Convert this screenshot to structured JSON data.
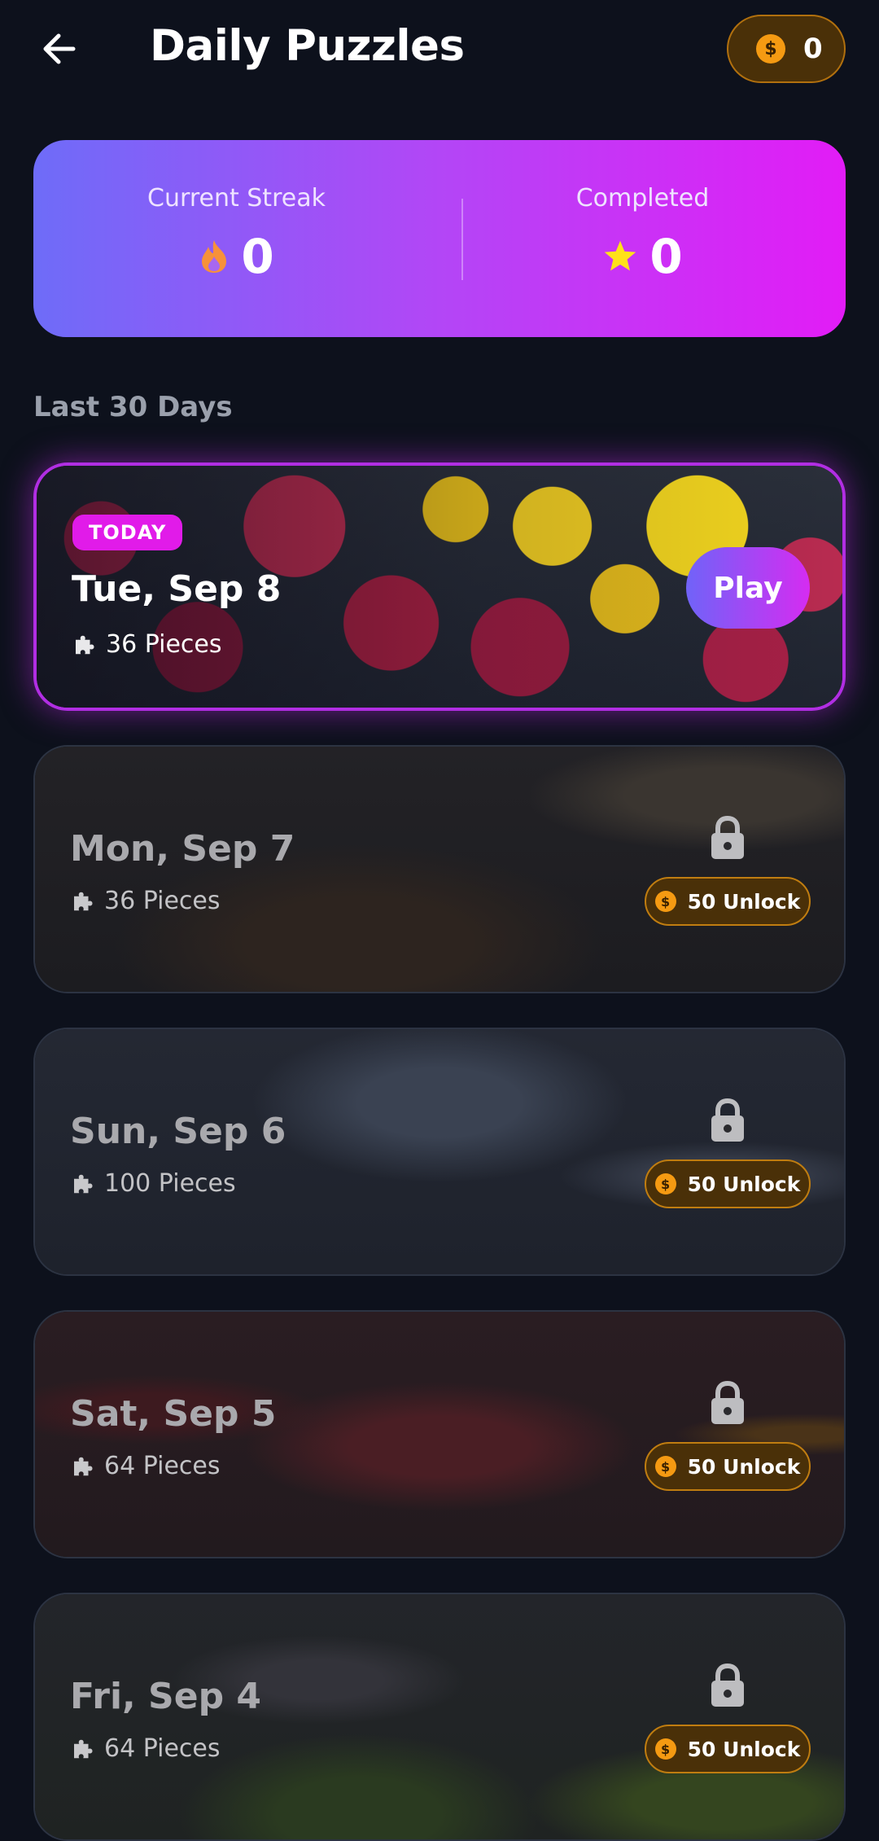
{
  "header": {
    "title": "Daily Puzzles",
    "coins": "0"
  },
  "stats": {
    "streak_label": "Current Streak",
    "streak_value": "0",
    "completed_label": "Completed",
    "completed_value": "0"
  },
  "section_label": "Last 30 Days",
  "today": {
    "badge": "TODAY",
    "date": "Tue, Sep 8",
    "pieces": "36 Pieces",
    "play_label": "Play"
  },
  "puzzles": [
    {
      "date": "Mon, Sep 7",
      "pieces": "36 Pieces",
      "unlock_label": "50 Unlock"
    },
    {
      "date": "Sun, Sep 6",
      "pieces": "100 Pieces",
      "unlock_label": "50 Unlock"
    },
    {
      "date": "Sat, Sep 5",
      "pieces": "64 Pieces",
      "unlock_label": "50 Unlock"
    },
    {
      "date": "Fri, Sep 4",
      "pieces": "64 Pieces",
      "unlock_label": "50 Unlock"
    }
  ],
  "icons": {
    "back": "arrow-left-icon",
    "coin": "coin-icon",
    "flame": "flame-icon",
    "star": "star-icon",
    "puzzle": "puzzle-piece-icon",
    "lock": "lock-icon"
  },
  "colors": {
    "background": "#0d111c",
    "accent_magenta": "#e11be9",
    "accent_violet": "#6e6cf8",
    "coin": "#f59a12",
    "star": "#ffe11a"
  }
}
